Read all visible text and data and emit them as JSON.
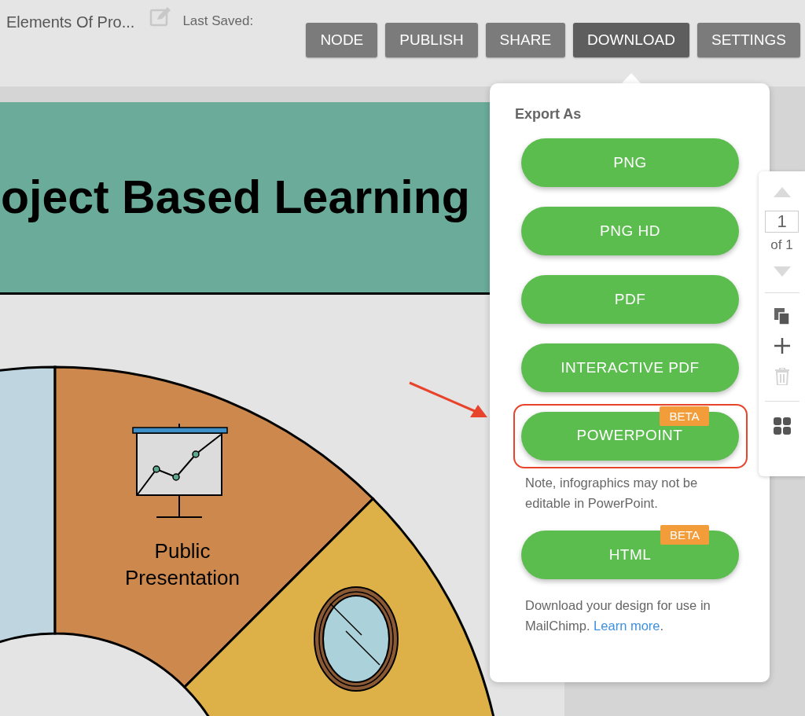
{
  "document": {
    "title": "Elements Of Pro...",
    "last_saved_label": "Last Saved:"
  },
  "toolbar": [
    {
      "label": "NODE",
      "selected": false
    },
    {
      "label": "PUBLISH",
      "selected": false
    },
    {
      "label": "SHARE",
      "selected": false
    },
    {
      "label": "DOWNLOAD",
      "selected": true
    },
    {
      "label": "SETTINGS",
      "selected": false
    }
  ],
  "canvas": {
    "title": "oject Based Learning",
    "segments": [
      {
        "color": "#bfd6e0"
      },
      {
        "color": "#cd884d",
        "label": "Public Presentation",
        "kind": "presentation"
      },
      {
        "color": "#deb148",
        "kind": "mirror"
      }
    ]
  },
  "export_menu": {
    "heading": "Export As",
    "options": [
      {
        "label": "PNG",
        "highlighted": false
      },
      {
        "label": "PNG HD",
        "highlighted": false
      },
      {
        "label": "PDF",
        "highlighted": false
      },
      {
        "label": "INTERACTIVE PDF",
        "highlighted": false
      },
      {
        "label": "POWERPOINT",
        "badge": "BETA",
        "highlighted": true,
        "note": "Note, infographics may not be editable in PowerPoint."
      },
      {
        "label": "HTML",
        "badge": "BETA",
        "highlighted": false,
        "note": "Download your design for use in MailChimp.",
        "note_link": "Learn more",
        "note_end": "."
      }
    ]
  },
  "pager": {
    "page": "1",
    "of": "of 1",
    "delete_disabled": true
  }
}
